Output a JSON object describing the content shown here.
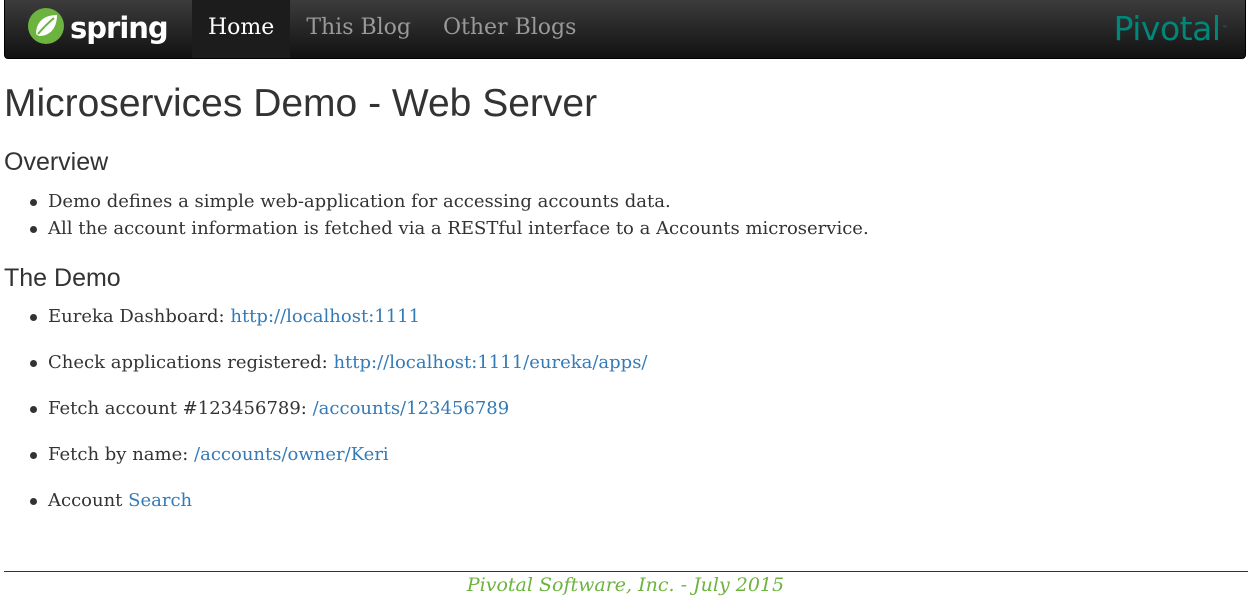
{
  "navbar": {
    "brand_label": "spring",
    "brand_icon": "spring-leaf-icon",
    "items": [
      {
        "label": "Home",
        "active": true
      },
      {
        "label": "This Blog",
        "active": false
      },
      {
        "label": "Other Blogs",
        "active": false
      }
    ],
    "partner_label": "Pivotal",
    "partner_mark": "™"
  },
  "page": {
    "title": "Microservices Demo - Web Server"
  },
  "overview": {
    "heading": "Overview",
    "items": [
      "Demo defines a simple web-application for accessing accounts data.",
      "All the account information is fetched via a RESTful interface to a Accounts microservice."
    ]
  },
  "demo": {
    "heading": "The Demo",
    "items": [
      {
        "text": "Eureka Dashboard: ",
        "link": "http://localhost:1111"
      },
      {
        "text": "Check applications registered: ",
        "link": "http://localhost:1111/eureka/apps/"
      },
      {
        "text": "Fetch account #123456789: ",
        "link": "/accounts/123456789"
      },
      {
        "text": "Fetch by name: ",
        "link": "/accounts/owner/Keri"
      },
      {
        "text": "Account ",
        "link": "Search"
      }
    ]
  },
  "footer": {
    "text": "Pivotal Software, Inc. - July 2015"
  },
  "colors": {
    "link": "#337ab7",
    "footer": "#6db33f",
    "spring_green": "#6db33f",
    "pivotal_teal": "#00877a",
    "navbar_dark": "#222222"
  }
}
